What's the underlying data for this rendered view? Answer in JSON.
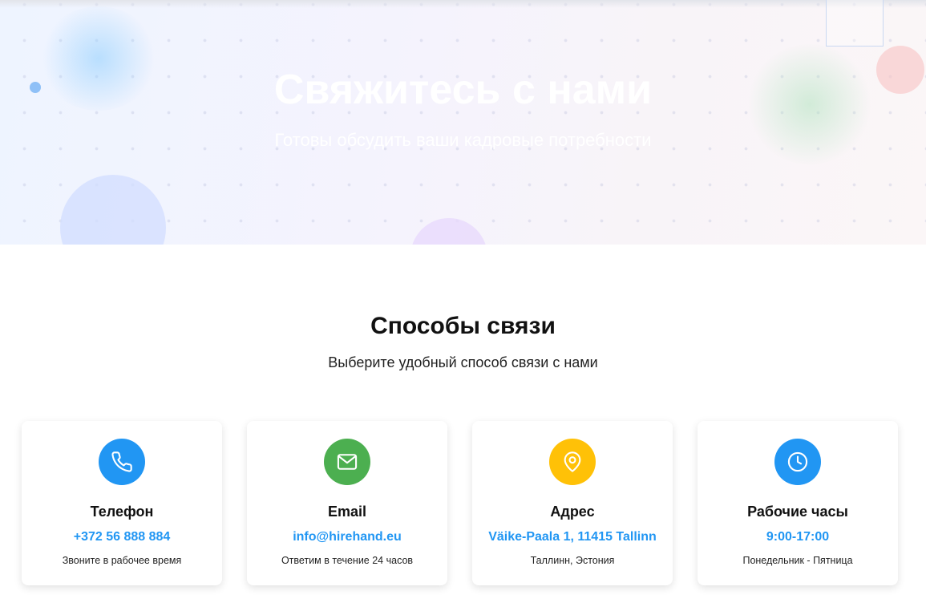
{
  "hero": {
    "title": "Свяжитесь с нами",
    "subtitle": "Готовы обсудить ваши кадровые потребности"
  },
  "contact_section": {
    "title": "Способы связи",
    "subtitle": "Выберите удобный способ связи с нами"
  },
  "cards": [
    {
      "title": "Телефон",
      "value": "+372 56 888 884",
      "note": "Звоните в рабочее время",
      "icon": "phone-icon",
      "icon_color": "#2196f3",
      "value_color": "#2196f3"
    },
    {
      "title": "Email",
      "value": "info@hirehand.eu",
      "note": "Ответим в течение 24 часов",
      "icon": "envelope-icon",
      "icon_color": "#4caf50",
      "value_color": "#2196f3"
    },
    {
      "title": "Адрес",
      "value": "Väike-Paala 1, 11415 Tallinn",
      "note": "Таллинн, Эстония",
      "icon": "map-pin-icon",
      "icon_color": "#ffc107",
      "value_color": "#2196f3"
    },
    {
      "title": "Рабочие часы",
      "value": "9:00-17:00",
      "note": "Понедельник - Пятница",
      "icon": "clock-icon",
      "icon_color": "#2196f3",
      "value_color": "#2196f3"
    }
  ]
}
